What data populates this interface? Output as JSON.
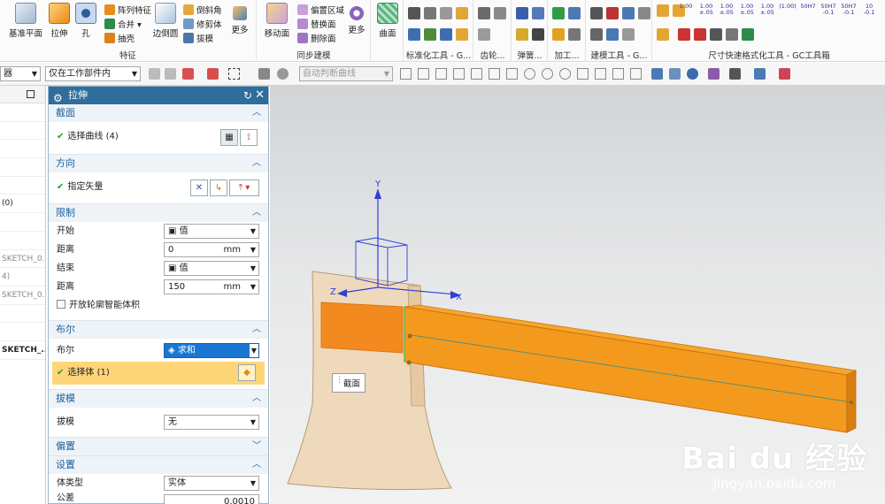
{
  "ribbon": {
    "features": {
      "group_title": "特征",
      "datum_plane": "基准平面",
      "extrude": "拉伸",
      "hole": "孔",
      "pattern_feature": "阵列特征",
      "unite": "合并 ▾",
      "shell": "抽壳",
      "edge_blend": "边倒圆",
      "chamfer": "倒斜角",
      "trim_body": "修剪体",
      "draft": "拔模",
      "more": "更多"
    },
    "sync": {
      "group_title": "同步建模",
      "move_face": "移动面",
      "offset_region": "偏置区域",
      "replace_face": "替换面",
      "delete_face": "删除面",
      "more": "更多"
    },
    "surface": {
      "label": "曲面"
    },
    "tab_labels": [
      "标准化工具 - G...",
      "齿轮...",
      "弹簧...",
      "加工...",
      "建模工具 - G...",
      "尺寸快速格式化工具 - GC工具箱"
    ],
    "dim_labels": [
      "1.00",
      "1.00\n±.05",
      "1.00\n±.05",
      "1.00\n±.05",
      "1.00\n±.05",
      "(1.00)",
      "50H7",
      "50H7\n-0.1",
      "50H7\n-0.1",
      "10\n-0.1"
    ]
  },
  "toolbar": {
    "filter_left": "器",
    "scope": "仅在工作部件内",
    "curve_rule": "自动判断曲线"
  },
  "tree": {
    "rows": [
      "",
      "",
      "",
      "",
      "",
      "(0)",
      "",
      "",
      "SKETCH_0..",
      "4)",
      "SKETCH_0..",
      "",
      "",
      "SKETCH_.."
    ]
  },
  "dialog": {
    "title": "拉伸",
    "section_curve": {
      "header": "截面",
      "select_curve": "选择曲线 (4)"
    },
    "section_direction": {
      "header": "方向",
      "specify_vector": "指定矢量"
    },
    "section_limits": {
      "header": "限制",
      "start_label": "开始",
      "start_value": "值",
      "distance1_label": "距离",
      "distance1_value": "0",
      "distance1_unit": "mm",
      "end_label": "结束",
      "end_value": "值",
      "distance2_label": "距离",
      "distance2_value": "150",
      "distance2_unit": "mm",
      "open_profile": "开放轮廓智能体积"
    },
    "section_boolean": {
      "header": "布尔",
      "boolean_label": "布尔",
      "boolean_value": "求和",
      "select_body": "选择体 (1)"
    },
    "section_draft": {
      "header": "拔模",
      "draft_label": "拔模",
      "draft_value": "无"
    },
    "section_offset": {
      "header": "偏置"
    },
    "section_settings": {
      "header": "设置",
      "body_type_label": "体类型",
      "body_type_value": "实体",
      "tolerance_label": "公差",
      "tolerance_value": "0.0010"
    }
  },
  "viewport": {
    "tooltip": "截面",
    "axis_y": "Y",
    "axis_z": "Z",
    "axis_x": "X",
    "watermark_brand": "Bai du 经验",
    "watermark_url": "jingyan.baidu.com"
  },
  "colors": {
    "title_bar": "#2f6d9c",
    "section_header": "#1c5f9a",
    "handle": "#f39a1e",
    "head": "#efd9bc",
    "selected_boolean": "#1976d2",
    "highlight_row": "#ffd57a"
  }
}
